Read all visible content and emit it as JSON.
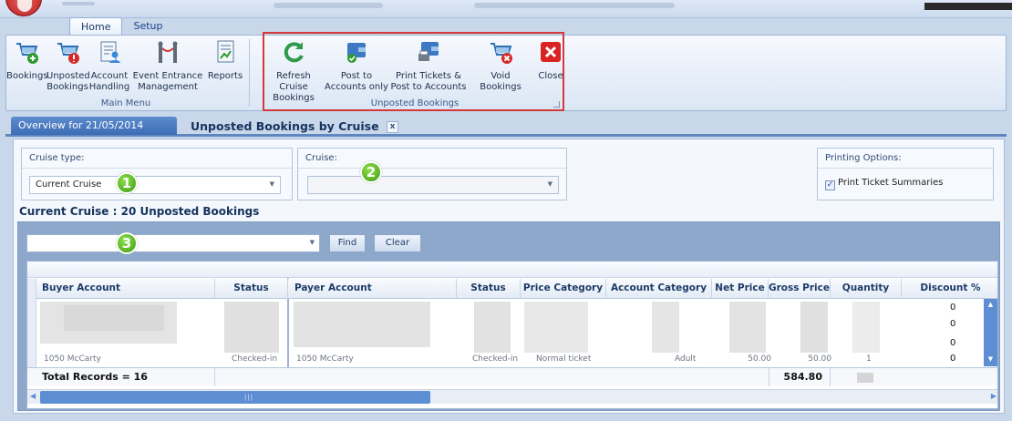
{
  "ribbon_tabs": [
    "Home",
    "Setup"
  ],
  "ribbon": {
    "main_buttons": [
      {
        "label1": "Bookings",
        "label2": "",
        "icon": "cart-add-icon"
      },
      {
        "label1": "Unposted",
        "label2": "Bookings",
        "icon": "cart-warning-icon"
      },
      {
        "label1": "Account",
        "label2": "Handling",
        "icon": "account-user-icon"
      },
      {
        "label1": "Event Entrance",
        "label2": "Management",
        "icon": "gate-entrance-icon"
      },
      {
        "label1": "Reports",
        "label2": "",
        "icon": "report-chart-icon"
      }
    ],
    "main_group_label": "Main Menu",
    "unposted_buttons": [
      {
        "label1": "Refresh Cruise",
        "label2": "Bookings",
        "icon": "refresh-icon"
      },
      {
        "label1": "Post to",
        "label2": "Accounts only",
        "icon": "post-accounts-icon"
      },
      {
        "label1": "Print Tickets &",
        "label2": "Post to Accounts",
        "icon": "print-post-icon"
      },
      {
        "label1": "Void Bookings",
        "label2": "",
        "icon": "cart-void-icon"
      }
    ],
    "unposted_group_label": "Unposted Bookings",
    "close_label": "Close"
  },
  "doc_tabs": {
    "overview": "Overview for 21/05/2014",
    "active": "Unposted Bookings by Cruise",
    "close_glyph": "x"
  },
  "filters": {
    "cruise_type_label": "Cruise type:",
    "cruise_type_value": "Current Cruise",
    "cruise_label": "Cruise:",
    "cruise_value": "",
    "printing_label": "Printing Options:",
    "print_summaries_label": "Print Ticket Summaries",
    "print_summaries_checked": true
  },
  "badges": [
    "1",
    "2",
    "3"
  ],
  "summary_title": "Current Cruise : 20  Unposted Bookings",
  "search": {
    "value": "",
    "find_label": "Find",
    "clear_label": "Clear"
  },
  "grid": {
    "columns": [
      "Buyer Account",
      "Status",
      "Payer Account",
      "Status",
      "Price Category",
      "Account Category",
      "Net Price",
      "Gross Price",
      "Quantity",
      "Discount %"
    ],
    "last_row": {
      "buyer": "1050 McCarty",
      "status": "Checked-in",
      "payer": "1050 McCarty",
      "payer_status": "Checked-in",
      "price_category": "Normal ticket",
      "account_category": "Adult",
      "net": "50.00",
      "gross": "50.00",
      "quantity": "1"
    },
    "discounts": [
      "0",
      "0",
      "0",
      "0"
    ],
    "total_records": "Total Records = 16",
    "gross_total": "584.80"
  },
  "colors": {
    "highlight": "#d23a3a",
    "badge": "#4fae1d",
    "tab": "#4a79c0"
  }
}
